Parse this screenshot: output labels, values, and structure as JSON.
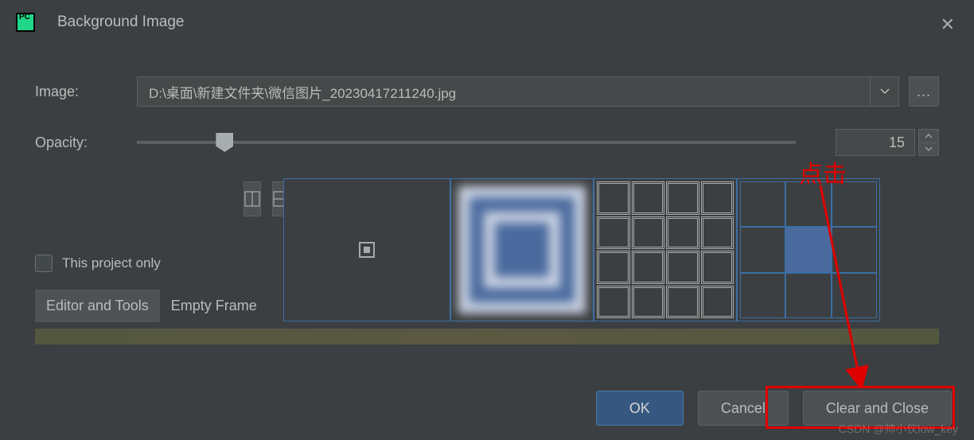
{
  "window": {
    "title": "Background Image"
  },
  "fields": {
    "image_label": "Image:",
    "image_path": "D:\\桌面\\新建文件夹\\微信图片_20230417211240.jpg",
    "browse_label": "...",
    "opacity_label": "Opacity:",
    "opacity_value": "15"
  },
  "options": {
    "this_project_only": "This project only"
  },
  "tabs": {
    "editor": "Editor and Tools",
    "empty": "Empty Frame"
  },
  "buttons": {
    "ok": "OK",
    "cancel": "Cancel",
    "clear": "Clear and Close"
  },
  "annotation": {
    "text": "点击"
  },
  "watermark": "CSDN @帅小伙low_key"
}
